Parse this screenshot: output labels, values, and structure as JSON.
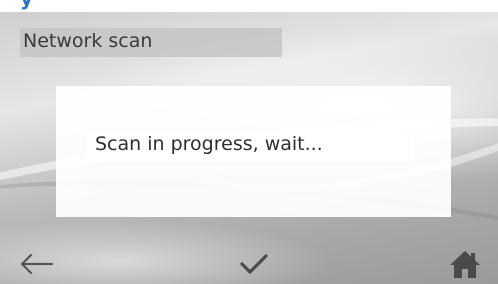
{
  "screen": {
    "title": "Network scan",
    "status_message": "Scan in progress, wait..."
  },
  "navigation": {
    "back_icon": "arrow-left-icon",
    "confirm_icon": "check-icon",
    "home_icon": "home-icon"
  },
  "colors": {
    "header_text_blue": "#2f72c8",
    "title_bar_background": "#c4c4c4",
    "dialog_background": "#ffffff",
    "icon_color": "#4a4a4a"
  }
}
